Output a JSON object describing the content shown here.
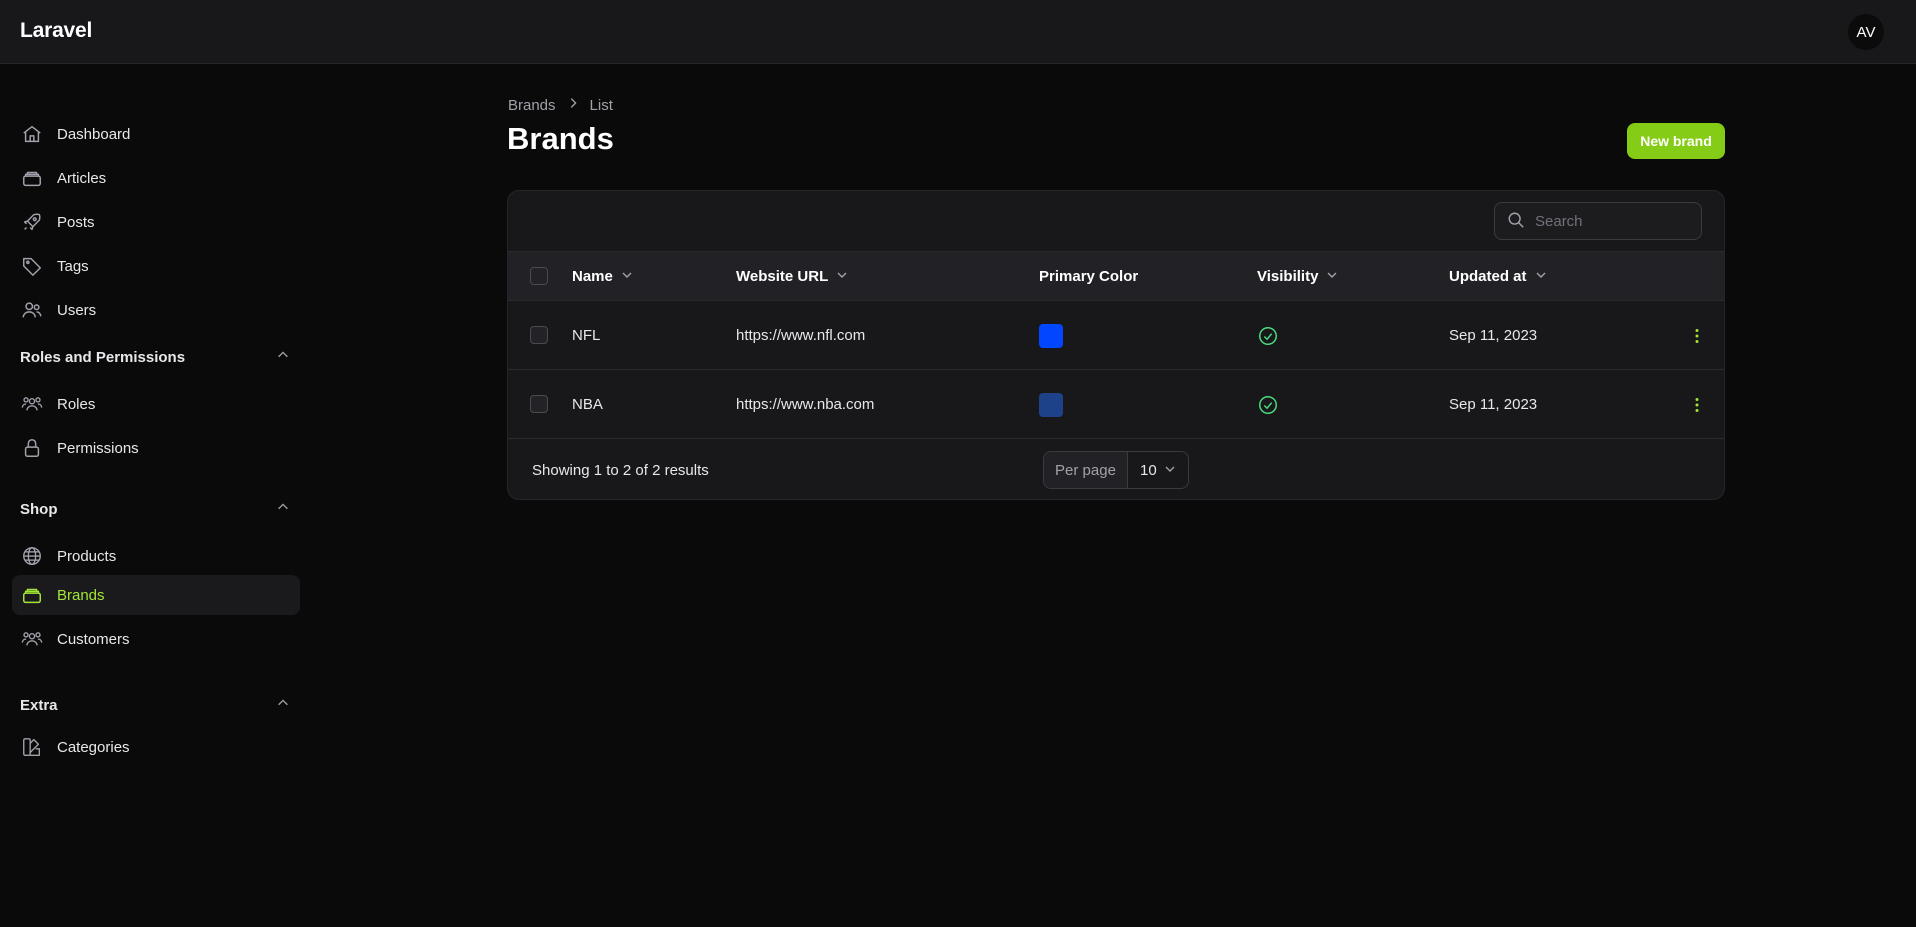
{
  "app": {
    "logo": "Laravel",
    "avatar_initials": "AV"
  },
  "sidebar": {
    "items": [
      {
        "label": "Dashboard",
        "icon": "home-icon"
      },
      {
        "label": "Articles",
        "icon": "stack-icon"
      },
      {
        "label": "Posts",
        "icon": "rocket-icon"
      },
      {
        "label": "Tags",
        "icon": "tag-icon"
      },
      {
        "label": "Users",
        "icon": "users-icon"
      }
    ],
    "groups": [
      {
        "label": "Roles and Permissions",
        "items": [
          {
            "label": "Roles",
            "icon": "user-group-icon"
          },
          {
            "label": "Permissions",
            "icon": "lock-icon"
          }
        ]
      },
      {
        "label": "Shop",
        "items": [
          {
            "label": "Products",
            "icon": "globe-icon"
          },
          {
            "label": "Brands",
            "icon": "stack-icon",
            "active": true
          },
          {
            "label": "Customers",
            "icon": "user-group-icon"
          }
        ]
      },
      {
        "label": "Extra",
        "items": [
          {
            "label": "Categories",
            "icon": "swatch-icon"
          }
        ]
      }
    ]
  },
  "breadcrumb": [
    "Brands",
    "List"
  ],
  "page": {
    "title": "Brands",
    "new_button": "New brand"
  },
  "search": {
    "placeholder": "Search",
    "value": ""
  },
  "table": {
    "columns": [
      "Name",
      "Website URL",
      "Primary Color",
      "Visibility",
      "Updated at"
    ],
    "rows": [
      {
        "name": "NFL",
        "url": "https://www.nfl.com",
        "color": "#0047ff",
        "visible": true,
        "updated": "Sep 11, 2023"
      },
      {
        "name": "NBA",
        "url": "https://www.nba.com",
        "color": "#1d428a",
        "visible": true,
        "updated": "Sep 11, 2023"
      }
    ]
  },
  "pagination": {
    "results": "Showing 1 to 2 of 2 results",
    "per_page_label": "Per page",
    "per_page_value": "10"
  },
  "colors": {
    "accent": "#84cc16",
    "accent_text": "#a3e635",
    "success": "#4ade80"
  }
}
